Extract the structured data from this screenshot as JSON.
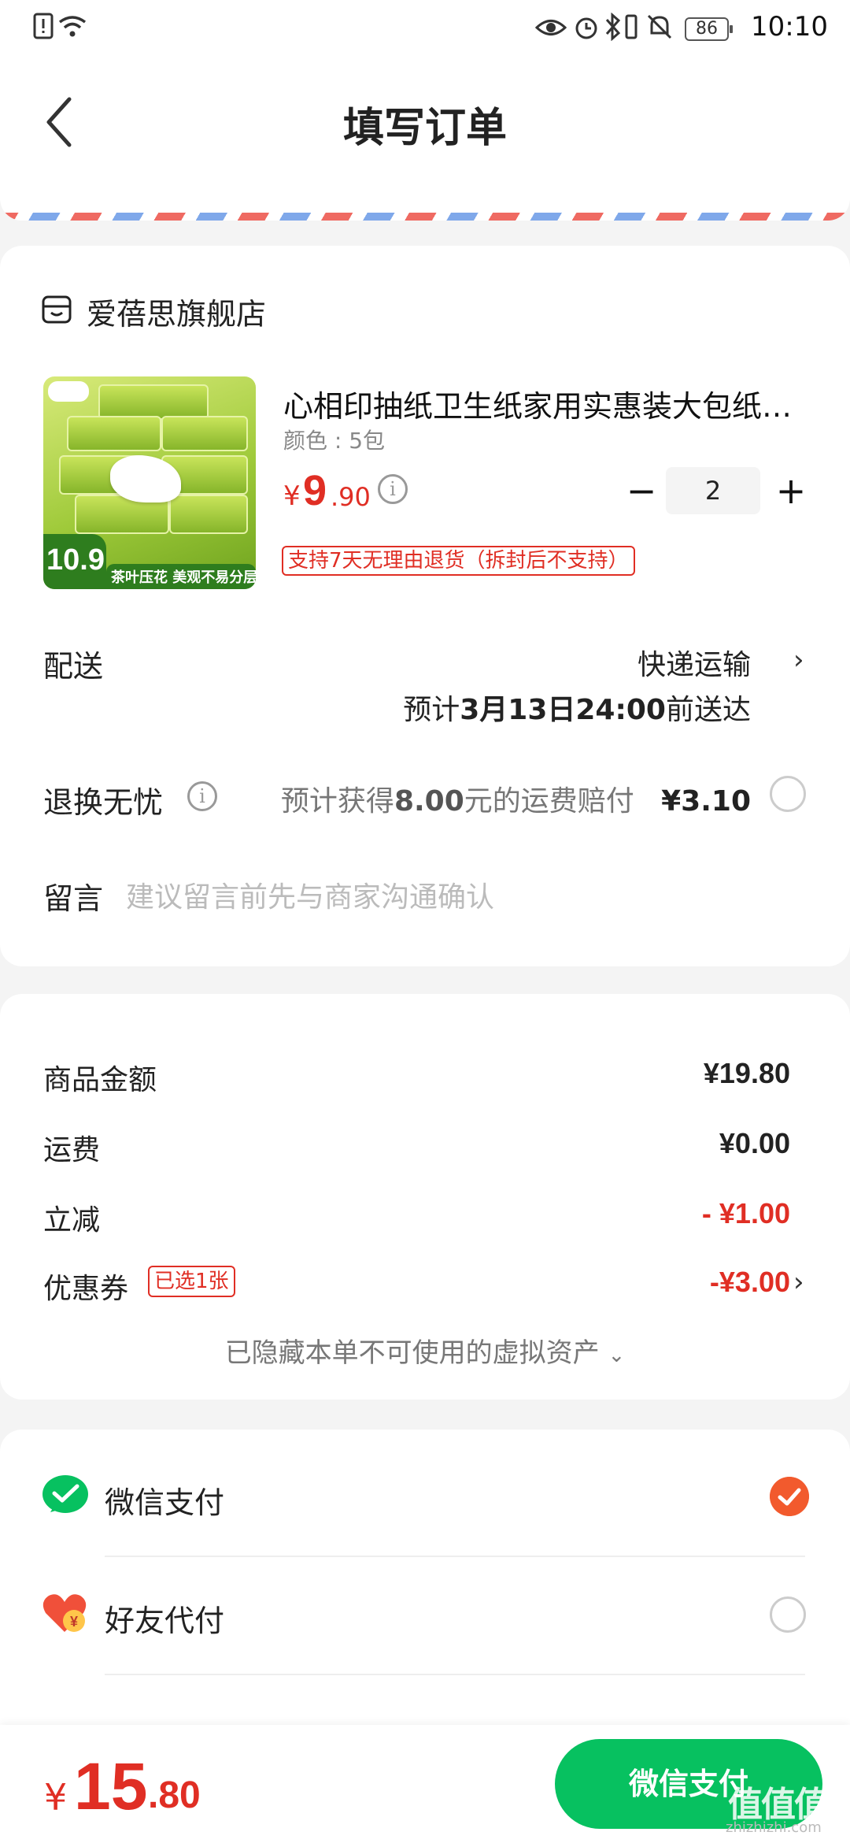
{
  "status_bar": {
    "time": "10:10",
    "battery": "86",
    "left_icons": [
      "sim-alert-icon",
      "wifi-icon"
    ],
    "right_icons": [
      "eye-icon",
      "alarm-icon",
      "bluetooth-icon",
      "vibrate-icon",
      "mute-icon"
    ]
  },
  "header": {
    "title": "填写订单",
    "back_icon": "back-arrow-icon"
  },
  "shop": {
    "name": "爱蓓思旗舰店",
    "product": {
      "title": "心相印抽纸卫生纸家用实惠装大包纸…",
      "spec": "颜色 : 5包",
      "price_symbol": "¥",
      "price_int": "9",
      "price_dec": ".90",
      "quantity": "2",
      "minus_label": "−",
      "plus_label": "+",
      "return_policy": "支持7天无理由退货（拆封后不支持）",
      "image": {
        "price_badge": "10.9",
        "banner": "茶叶压花 美观不易分层"
      }
    },
    "delivery": {
      "label": "配送",
      "method": "快递运输",
      "eta_prefix": "预计",
      "eta_date": "3月13日24:00",
      "eta_suffix": "前送达"
    },
    "worry_free": {
      "label": "退换无忧",
      "prefix": "预计获得",
      "amount": "8.00",
      "suffix": "元的运费赔付",
      "price": "¥3.10",
      "selected": false
    },
    "message": {
      "label": "留言",
      "placeholder": "建议留言前先与商家沟通确认"
    }
  },
  "summary": {
    "goods_label": "商品金额",
    "goods_value": "¥19.80",
    "shipping_label": "运费",
    "shipping_value": "¥0.00",
    "discount_label": "立减",
    "discount_value": "- ¥1.00",
    "coupon_label": "优惠券",
    "coupon_tag": "已选1张",
    "coupon_value": "-¥3.00",
    "hidden_note": "已隐藏本单不可使用的虚拟资产"
  },
  "payment": {
    "options": [
      {
        "label": "微信支付",
        "icon": "wechat-pay-icon",
        "selected": true
      },
      {
        "label": "好友代付",
        "icon": "friend-pay-heart-icon",
        "selected": false
      }
    ],
    "brand_color": "#07c160",
    "accent_color": "#e02e24"
  },
  "bottom": {
    "total_symbol": "¥",
    "total_int": "15",
    "total_dec": ".80",
    "pay_button": "微信支付",
    "watermark": "值值值",
    "watermark_sub": "zhizhizhi.com"
  }
}
